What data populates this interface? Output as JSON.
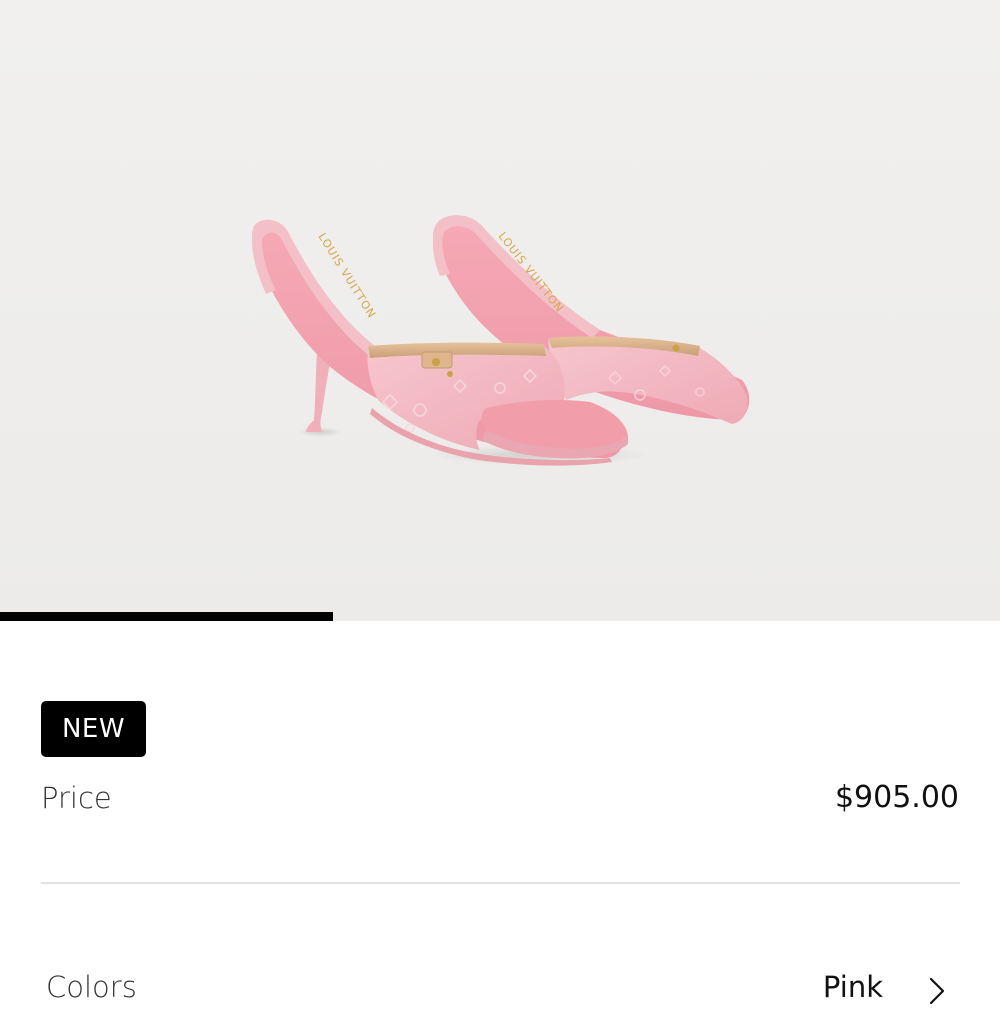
{
  "gallery": {
    "image_alt": "Pink monogram canvas heeled mule sandals",
    "progress": 0.333,
    "brand_text": "LOUIS VUITTON"
  },
  "product": {
    "badge": "NEW",
    "price_label": "Price",
    "price_value": "$905.00"
  },
  "colors": {
    "label": "Colors",
    "value": "Pink",
    "chevron_icon": "chevron-right-icon"
  },
  "palette": {
    "badge_bg": "#000000",
    "product_pink": "#f2b3bd",
    "strap_tan": "#d9b087"
  }
}
